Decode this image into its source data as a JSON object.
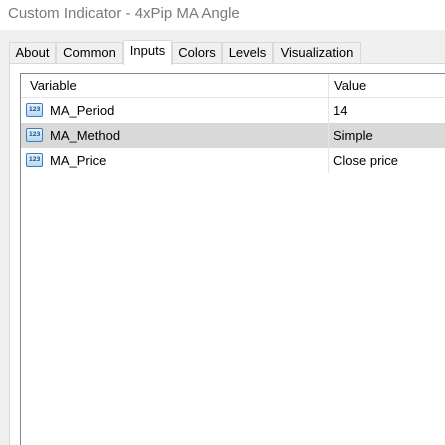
{
  "window": {
    "title": "Custom Indicator - 4xPip MA Angle"
  },
  "tabs": [
    {
      "label": "About",
      "active": false
    },
    {
      "label": "Common",
      "active": false
    },
    {
      "label": "Inputs",
      "active": true
    },
    {
      "label": "Colors",
      "active": false
    },
    {
      "label": "Levels",
      "active": false
    },
    {
      "label": "Visualization",
      "active": false
    }
  ],
  "inputs_grid": {
    "columns": [
      "Variable",
      "Value"
    ],
    "rows": [
      {
        "variable": "MA_Period",
        "value": "14",
        "icon": "integer-param-icon",
        "icon_text": "123",
        "selected": false
      },
      {
        "variable": "MA_Method",
        "value": "Simple",
        "icon": "integer-param-icon",
        "icon_text": "123",
        "selected": true
      },
      {
        "variable": "MA_Price",
        "value": "Close price",
        "icon": "integer-param-icon",
        "icon_text": "123",
        "selected": false
      }
    ]
  },
  "colors": {
    "selected_row": "#d9d9d9",
    "icon_border": "#3d7fc0",
    "title_text": "#7a7a7a"
  }
}
